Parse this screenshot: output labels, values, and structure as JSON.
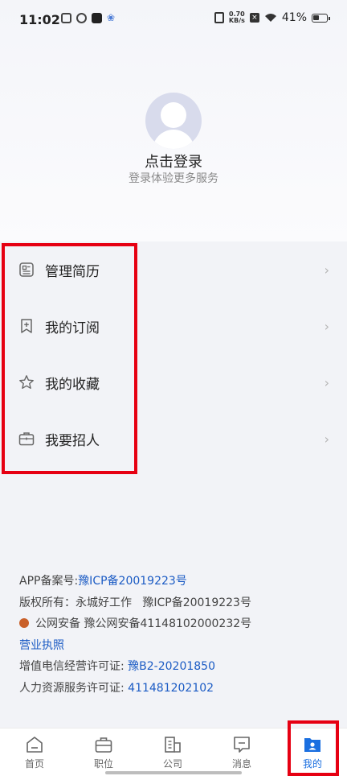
{
  "status_bar": {
    "time": "11:02",
    "net_speed_value": "0.70",
    "net_speed_unit": "KB/s",
    "battery": "41%"
  },
  "profile": {
    "login_title": "点击登录",
    "login_subtitle": "登录体验更多服务"
  },
  "menu": [
    {
      "label": "管理简历",
      "icon": "resume-icon"
    },
    {
      "label": "我的订阅",
      "icon": "bookmark-plus-icon"
    },
    {
      "label": "我的收藏",
      "icon": "star-icon"
    },
    {
      "label": "我要招人",
      "icon": "briefcase-icon"
    }
  ],
  "info": {
    "app_record_label": "APP备案号:",
    "app_record_value": "豫ICP备20019223号",
    "copyright": "版权所有：永城好工作   豫ICP备20019223号",
    "public_security": "公网安备 豫公网安备41148102000232号",
    "business_license": "营业执照",
    "telecom_label": "增值电信经营许可证: ",
    "telecom_value": "豫B2-20201850",
    "hr_label": "人力资源服务许可证: ",
    "hr_value": "411481202102"
  },
  "nav": [
    {
      "label": "首页",
      "icon": "home-icon"
    },
    {
      "label": "职位",
      "icon": "briefcase-icon"
    },
    {
      "label": "公司",
      "icon": "building-icon"
    },
    {
      "label": "消息",
      "icon": "message-icon"
    },
    {
      "label": "我的",
      "icon": "profile-icon",
      "active": true
    }
  ],
  "colors": {
    "accent": "#1a6fe0",
    "link": "#1b5bc4",
    "highlight": "#e60012"
  }
}
